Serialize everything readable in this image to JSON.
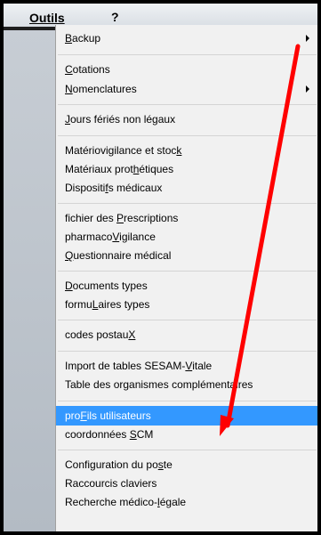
{
  "menubar": {
    "menu_label": "Outils",
    "next_menu_label": "?"
  },
  "menu": {
    "items": [
      {
        "pre": "",
        "ul": "B",
        "post": "ackup",
        "submenu": true
      },
      {
        "pre": "",
        "ul": "C",
        "post": "otations",
        "submenu": false
      },
      {
        "pre": "",
        "ul": "N",
        "post": "omenclatures",
        "submenu": true
      },
      {
        "pre": "",
        "ul": "J",
        "post": "ours fériés non légaux",
        "submenu": false
      },
      {
        "pre": "Matériovigilance et stoc",
        "ul": "k",
        "post": "",
        "submenu": false
      },
      {
        "pre": "Matériaux prot",
        "ul": "h",
        "post": "étiques",
        "submenu": false
      },
      {
        "pre": "Dispositi",
        "ul": "f",
        "post": "s médicaux",
        "submenu": false
      },
      {
        "pre": "fichier des ",
        "ul": "P",
        "post": "rescriptions",
        "submenu": false
      },
      {
        "pre": "pharmaco",
        "ul": "V",
        "post": "igilance",
        "submenu": false
      },
      {
        "pre": "",
        "ul": "Q",
        "post": "uestionnaire médical",
        "submenu": false
      },
      {
        "pre": "",
        "ul": "D",
        "post": "ocuments types",
        "submenu": false
      },
      {
        "pre": "formu",
        "ul": "L",
        "post": "aires types",
        "submenu": false
      },
      {
        "pre": "codes postau",
        "ul": "X",
        "post": "",
        "submenu": false
      },
      {
        "pre": "Import de tables SESAM-",
        "ul": "V",
        "post": "itale",
        "submenu": false
      },
      {
        "pre": "Table des organismes complémentaires",
        "ul": "",
        "post": "",
        "submenu": false
      },
      {
        "pre": "pro",
        "ul": "F",
        "post": "ils utilisateurs",
        "submenu": false,
        "highlighted": true
      },
      {
        "pre": "coordonnées ",
        "ul": "S",
        "post": "CM",
        "submenu": false
      },
      {
        "pre": "Configuration du po",
        "ul": "s",
        "post": "te",
        "submenu": false
      },
      {
        "pre": "Raccourcis claviers",
        "ul": "",
        "post": "",
        "submenu": false
      },
      {
        "pre": "Recherche médico-",
        "ul": "l",
        "post": "égale",
        "submenu": false
      }
    ]
  },
  "annotation": {
    "color": "#ff0000"
  }
}
